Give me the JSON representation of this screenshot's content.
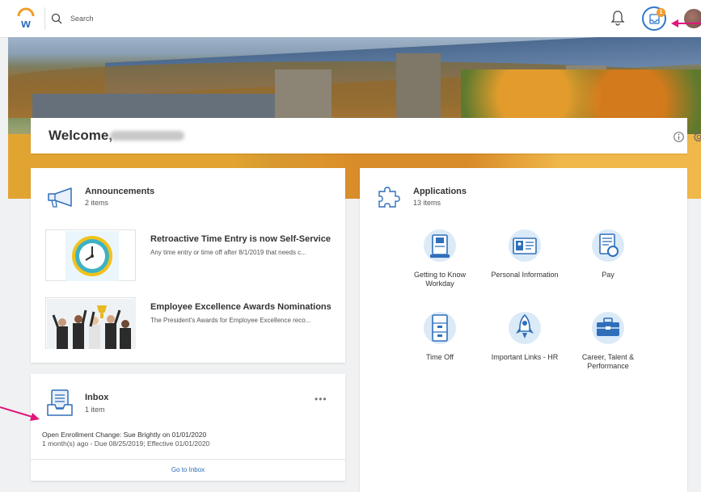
{
  "search": {
    "placeholder": "Search"
  },
  "welcome": {
    "greeting": "Welcome,"
  },
  "announcements": {
    "title": "Announcements",
    "count": "2 items",
    "items": [
      {
        "title": "Retroactive Time Entry is now Self-Service",
        "description": "Any time entry or time off after 8/1/2019 that needs c..."
      },
      {
        "title": "Employee Excellence Awards Nominations",
        "description": "The President's Awards for Employee Excellence reco..."
      }
    ]
  },
  "applications": {
    "title": "Applications",
    "count": "13 items",
    "items": [
      {
        "label": "Getting to Know Workday",
        "icon": "id-card-icon"
      },
      {
        "label": "Personal Information",
        "icon": "profile-card-icon"
      },
      {
        "label": "Pay",
        "icon": "pay-document-icon"
      },
      {
        "label": "Time Off",
        "icon": "file-cabinet-icon"
      },
      {
        "label": "Important Links - HR",
        "icon": "rocket-icon"
      },
      {
        "label": "Career, Talent & Performance",
        "icon": "briefcase-icon"
      }
    ]
  },
  "inbox": {
    "title": "Inbox",
    "count": "1 item",
    "task_title": "Open Enrollment Change: Sue Brightly on 01/01/2020",
    "task_meta": "1 month(s) ago - Due 08/25/2019; Effective 01/01/2020",
    "link": "Go to Inbox"
  },
  "notifications": {
    "badge": "1"
  },
  "colors": {
    "accent": "#2f77c9",
    "badge": "#f39c2c",
    "annotation_arrow": "#e1157a"
  }
}
